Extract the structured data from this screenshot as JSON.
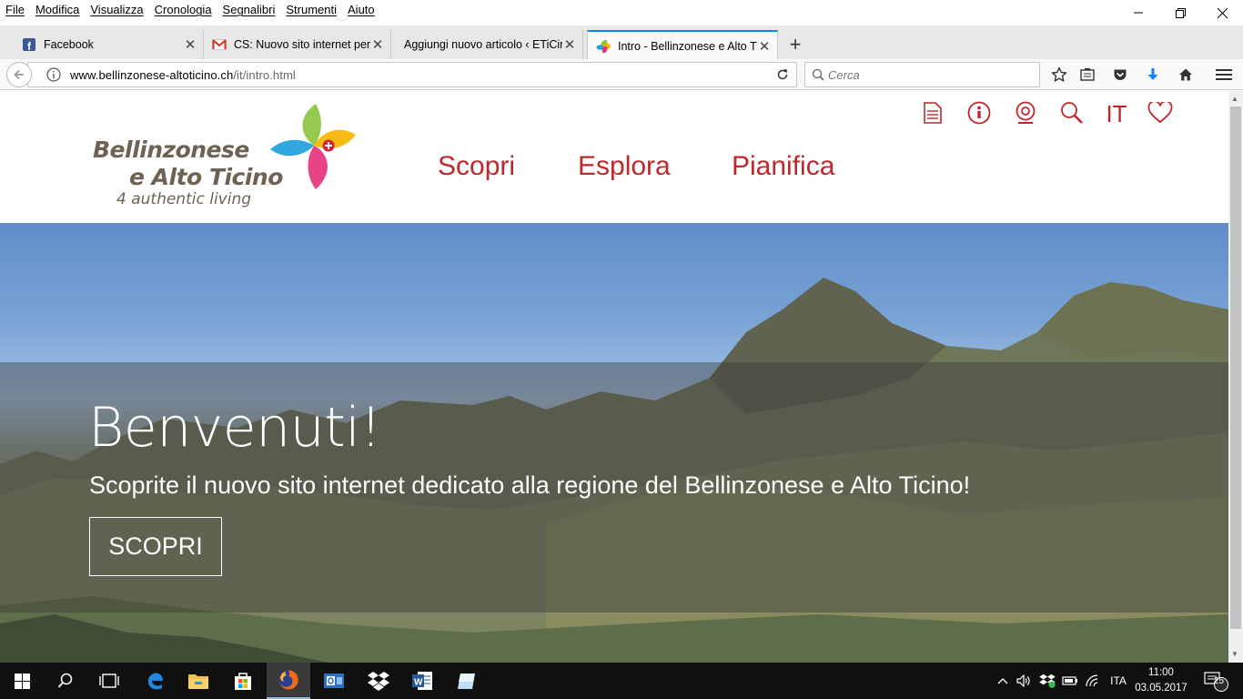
{
  "menubar": {
    "items": [
      "File",
      "Modifica",
      "Visualizza",
      "Cronologia",
      "Segnalibri",
      "Strumenti",
      "Aiuto"
    ]
  },
  "tabs": [
    {
      "title": "Facebook",
      "icon": "facebook-icon"
    },
    {
      "title": "CS: Nuovo sito internet per i",
      "icon": "gmail-icon"
    },
    {
      "title": "Aggiungi nuovo articolo ‹ ETiCin",
      "icon": ""
    },
    {
      "title": "Intro - Bellinzonese e Alto Ti",
      "icon": "site-flower-icon",
      "active": true
    }
  ],
  "urlbar": {
    "domain": "www.bellinzonese-altoticino.ch",
    "path": "/it/intro.html"
  },
  "search": {
    "placeholder": "Cerca"
  },
  "site": {
    "logo": {
      "line1": "Bellinzonese",
      "line2": "e Alto Ticino",
      "tagline": "4 authentic living"
    },
    "nav": [
      "Scopri",
      "Esplora",
      "Pianifica"
    ],
    "lang": "IT",
    "colors": {
      "accent": "#c0272d",
      "logo_text": "#6e6252"
    }
  },
  "hero": {
    "title": "Benvenuti!",
    "subtitle": "Scoprite il nuovo sito internet dedicato alla regione del Bellinzonese e Alto Ticino!",
    "button": "SCOPRI"
  },
  "taskbar": {
    "lang": "ITA",
    "time": "11:00",
    "date": "03.05.2017",
    "notifications": "25"
  }
}
